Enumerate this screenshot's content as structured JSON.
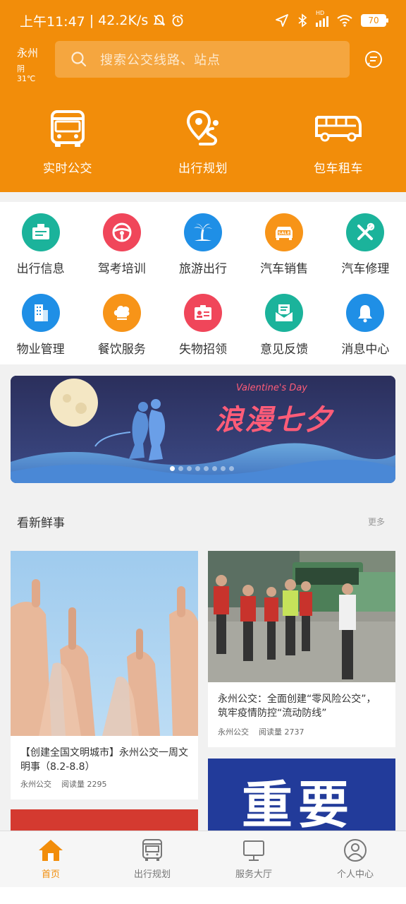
{
  "status_bar": {
    "time": "上午11:47",
    "net_speed": "42.2K/s",
    "battery": "70",
    "network": "HD"
  },
  "header": {
    "city": "永州",
    "weather": "阴 31℃",
    "search_placeholder": "搜索公交线路、站点"
  },
  "quick_actions": [
    {
      "label": "实时公交",
      "icon": "bus-icon"
    },
    {
      "label": "出行规划",
      "icon": "route-pin-icon"
    },
    {
      "label": "包车租车",
      "icon": "coach-icon"
    }
  ],
  "services": [
    {
      "label": "出行信息",
      "icon": "info-board-icon",
      "color": "#1bb39b"
    },
    {
      "label": "驾考培训",
      "icon": "steering-wheel-icon",
      "color": "#f0465a"
    },
    {
      "label": "旅游出行",
      "icon": "palm-tree-icon",
      "color": "#1f8fe6"
    },
    {
      "label": "汽车销售",
      "icon": "car-sale-icon",
      "color": "#f79418"
    },
    {
      "label": "汽车修理",
      "icon": "repair-tools-icon",
      "color": "#1bb39b"
    },
    {
      "label": "物业管理",
      "icon": "building-icon",
      "color": "#1f8fe6"
    },
    {
      "label": "餐饮服务",
      "icon": "chef-hat-icon",
      "color": "#f79418"
    },
    {
      "label": "失物招领",
      "icon": "id-card-icon",
      "color": "#f0465a"
    },
    {
      "label": "意见反馈",
      "icon": "feedback-mail-icon",
      "color": "#1bb39b"
    },
    {
      "label": "消息中心",
      "icon": "bell-icon",
      "color": "#1f8fe6"
    }
  ],
  "banner": {
    "title_en": "Valentine's Day",
    "title_cn": "浪漫七夕",
    "slide_count": 8,
    "active_slide": 0
  },
  "news": {
    "section_title": "看新鲜事",
    "more_label": "更多",
    "items": [
      {
        "title": "【创建全国文明城市】永州公交一周文明事（8.2-8.8）",
        "source": "永州公交",
        "reads": "阅读量 2295"
      },
      {
        "title": "永州公交：全面创建“零风险公交”，筑牢疫情防控“流动防线”",
        "source": "永州公交",
        "reads": "阅读量 2737"
      }
    ],
    "partial_card_text": "重要"
  },
  "bottom_nav": [
    {
      "label": "首页",
      "icon": "home-icon",
      "active": true
    },
    {
      "label": "出行规划",
      "icon": "bus-front-icon",
      "active": false
    },
    {
      "label": "服务大厅",
      "icon": "monitor-icon",
      "active": false
    },
    {
      "label": "个人中心",
      "icon": "user-icon",
      "active": false
    }
  ],
  "colors": {
    "brand": "#f28d0a"
  }
}
